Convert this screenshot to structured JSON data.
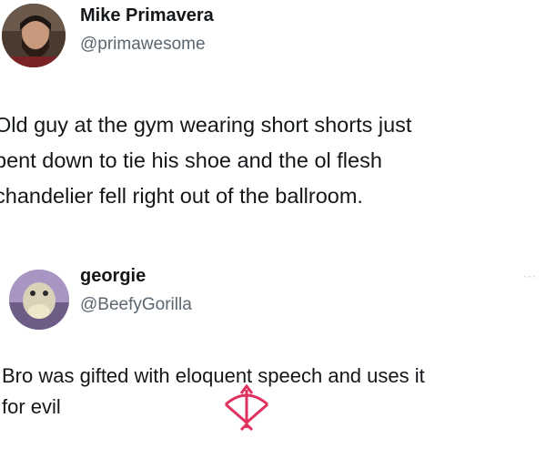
{
  "posts": [
    {
      "author": "Mike Primavera",
      "handle": "@primawesome",
      "text_lines": [
        "Old guy at the gym wearing short shorts just",
        "bent down to tie his shoe and the ol flesh",
        "chandelier fell right out of the ballroom."
      ],
      "avatar_icon": "profile-photo-man-beard"
    },
    {
      "author": "georgie",
      "handle": "@BeefyGorilla",
      "more_label": "···",
      "text_lines": [
        "Bro was gifted with eloquent speech and uses it",
        "for evil"
      ],
      "avatar_icon": "profile-photo-fish"
    }
  ],
  "colors": {
    "text": "#14171a",
    "secondary": "#5b6670",
    "watermark": "#e0305e"
  },
  "watermark_icon": "bow-and-arrow-icon"
}
